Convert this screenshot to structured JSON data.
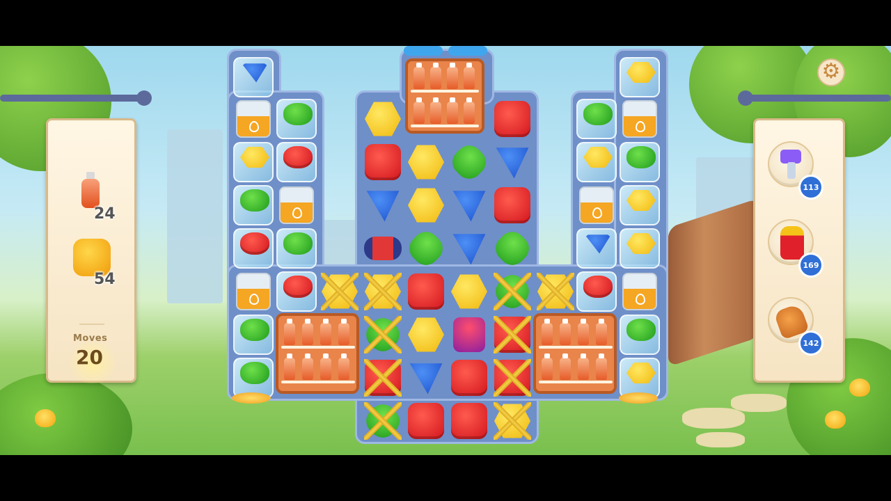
{
  "goals": [
    {
      "name": "bottle",
      "icon": "bottle-icon",
      "count": "24"
    },
    {
      "name": "honey",
      "icon": "honey-cube-icon",
      "count": "54"
    }
  ],
  "moves": {
    "label": "Moves",
    "value": "20"
  },
  "boosters": [
    {
      "icon": "hammer-booster-icon",
      "count": "113"
    },
    {
      "icon": "fire-hydrant-booster-icon",
      "count": "169"
    },
    {
      "icon": "glove-booster-icon",
      "count": "142"
    }
  ],
  "settings": {
    "icon": "gear-icon"
  },
  "colors": {
    "red": "#d1141c",
    "yellow": "#f0b60a",
    "green": "#1e9a1c",
    "blue": "#1649c9",
    "board": "#6f8fc8"
  },
  "board": {
    "rows": [
      [
        "ice-blue",
        null,
        null,
        null,
        null,
        null,
        null,
        null,
        null,
        null,
        "ice-yellow"
      ],
      [
        "jar",
        "ice-green",
        null,
        "yellow",
        null,
        null,
        "red",
        null,
        "ice-green",
        "jar"
      ],
      [
        "ice-yellow",
        "ice-red",
        null,
        "red",
        "yellow",
        "green",
        "blue",
        null,
        "ice-yellow",
        "ice-green"
      ],
      [
        "ice-green",
        "jar",
        null,
        "blue",
        "yellow",
        "blue",
        "red",
        null,
        "jar",
        "ice-yellow"
      ],
      [
        "ice-red",
        "ice-green",
        null,
        "rocket",
        "green",
        "blue",
        "green",
        null,
        "ice-blue",
        "ice-yellow"
      ],
      [
        "jar",
        "ice-red",
        "chain-yellow",
        "chain-yellow",
        "red",
        "yellow",
        "chain-green",
        "chain-yellow",
        "ice-red",
        "jar"
      ],
      [
        "ice-green",
        null,
        null,
        "chain-green",
        "yellow",
        "bomb",
        "chain-red",
        null,
        null,
        "ice-green"
      ],
      [
        "ice-green",
        null,
        null,
        "chain-red",
        "blue",
        "red",
        "chain-red",
        null,
        null,
        "ice-yellow"
      ],
      [
        null,
        null,
        null,
        "chain-green",
        "red",
        "red",
        "chain-yellow",
        null,
        null,
        null
      ]
    ]
  }
}
